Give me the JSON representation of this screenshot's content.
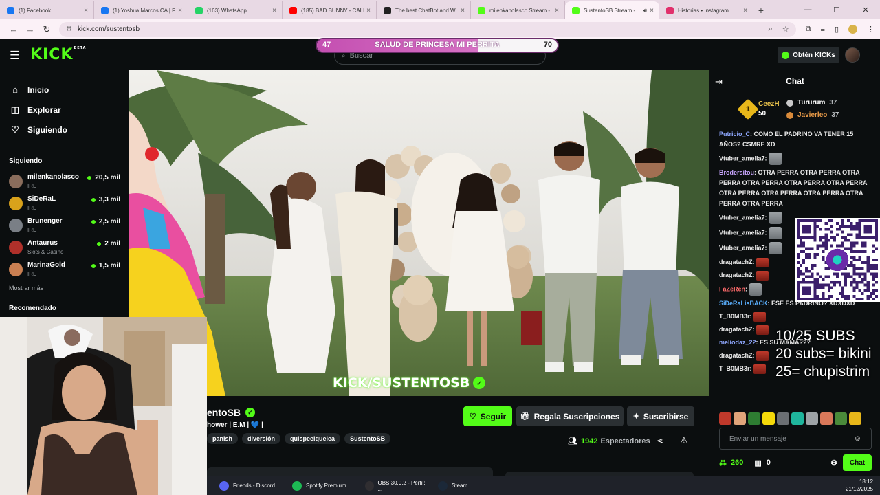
{
  "browser": {
    "tabs": [
      {
        "title": "(1) Facebook",
        "icon": "facebook-icon",
        "color": "#1877f2",
        "active": false
      },
      {
        "title": "(1) Yoshua Marcos CA | Fa",
        "icon": "facebook-icon",
        "color": "#1877f2",
        "active": false
      },
      {
        "title": "(163) WhatsApp",
        "icon": "whatsapp-icon",
        "color": "#25d366",
        "active": false
      },
      {
        "title": "(185) BAD BUNNY - CALL",
        "icon": "youtube-icon",
        "color": "#ff0000",
        "active": false
      },
      {
        "title": "The best ChatBot and W",
        "icon": "chatbot-icon",
        "color": "#222222",
        "active": false
      },
      {
        "title": "milenkanolasco Stream -",
        "icon": "kick-icon",
        "color": "#53fc18",
        "active": false
      },
      {
        "title": "SustentoSB Stream -",
        "icon": "kick-icon",
        "color": "#53fc18",
        "active": true
      },
      {
        "title": "Historias • Instagram",
        "icon": "instagram-icon",
        "color": "#e1306c",
        "active": false
      }
    ],
    "url": "kick.com/sustentosb"
  },
  "nav": {
    "logo": "KICK",
    "logo_badge": "BETA",
    "search_placeholder": "Buscar",
    "obten_kicks": "Obtén KICKs"
  },
  "goal": {
    "title": "SALUD DE PRINCESA MI PERRITA",
    "start": "47",
    "end": "70",
    "progress": 0.67
  },
  "sidebar": {
    "main": [
      {
        "label": "Inicio",
        "icon": "home-icon"
      },
      {
        "label": "Explorar",
        "icon": "compass-icon"
      },
      {
        "label": "Siguiendo",
        "icon": "heart-icon"
      }
    ],
    "following_title": "Siguiendo",
    "following": [
      {
        "name": "milenkanolasco",
        "category": "IRL",
        "viewers": "20,5 mil",
        "color": "#8a6d5c"
      },
      {
        "name": "SiDeRaL",
        "category": "IRL",
        "viewers": "3,3 mil",
        "color": "#d9a21b"
      },
      {
        "name": "Brunenger",
        "category": "IRL",
        "viewers": "2,5 mil",
        "color": "#7a7f86"
      },
      {
        "name": "Antaurus",
        "category": "Slots & Casino",
        "viewers": "2 mil",
        "color": "#b0302a"
      },
      {
        "name": "MarinaGold",
        "category": "IRL",
        "viewers": "1,5 mil",
        "color": "#c97f52"
      }
    ],
    "mostrar_mas": "Mostrar más",
    "recomendado": "Recomendado"
  },
  "video": {
    "watermark": "KICK/SUSTENTOSB"
  },
  "channel": {
    "name": "SustentoSB",
    "name_visible": "entoSB",
    "title_visible": "hower | E.M | 💙 |",
    "tags": [
      "panish",
      "diversión",
      "quispeelquelea",
      "SustentoSB"
    ],
    "follow": "Seguir",
    "gift": "Regala Suscripciones",
    "subscribe": "Suscribirse",
    "viewers": "1942",
    "viewers_label": "Espectadores"
  },
  "chat": {
    "title": "Chat",
    "leaderboard": [
      {
        "rank": "1",
        "name": "CeezH",
        "points": "50"
      },
      {
        "name": "Tururum",
        "points": "37",
        "color": "#c9c9c9"
      },
      {
        "name": "Javierleo",
        "points": "37",
        "color": "#d98a3a"
      }
    ],
    "messages": [
      {
        "user": "Putricio_C",
        "user_color": "#8fa8ff",
        "text": ": COMO EL PADRINO VA TENER 15 AÑOS? CSMRE XD",
        "emotes": 0,
        "emote_type": ""
      },
      {
        "user": "Vtuber_amelia7",
        "user_color": "#e8e8e8",
        "text": ":",
        "emotes": 1,
        "emote_type": "cat"
      },
      {
        "user": "Brodersitou",
        "user_color": "#c9a6ff",
        "text": ": OTRA PERRA  OTRA PERRA  OTRA PERRA  OTRA PERRA  OTRA PERRA  OTRA PERRA  OTRA PERRA  OTRA PERRA  OTRA PERRA  OTRA PERRA  OTRA PERRA",
        "emotes": 0,
        "emote_type": "red"
      },
      {
        "user": "Vtuber_amelia7",
        "user_color": "#e8e8e8",
        "text": ":",
        "emotes": 1,
        "emote_type": "cat"
      },
      {
        "user": "Vtuber_amelia7",
        "user_color": "#e8e8e8",
        "text": ":",
        "emotes": 1,
        "emote_type": "cat"
      },
      {
        "user": "Vtuber_amelia7",
        "user_color": "#e8e8e8",
        "text": ":",
        "emotes": 1,
        "emote_type": "cat"
      },
      {
        "user": "dragatachZ",
        "user_color": "#e8e8e8",
        "text": ":",
        "emotes": 1,
        "emote_type": "red"
      },
      {
        "user": "dragatachZ",
        "user_color": "#e8e8e8",
        "text": ":",
        "emotes": 1,
        "emote_type": "red"
      },
      {
        "user": "FaZeRen",
        "user_color": "#ff6b6b",
        "text": ":",
        "emotes": 1,
        "emote_type": "cat"
      },
      {
        "user": "SiDeRaLisBACK",
        "user_color": "#5ab0ff",
        "text": ": ESE ES PADRINO? XDXDXD",
        "emotes": 0,
        "emote_type": ""
      },
      {
        "user": "T_B0MB3r",
        "user_color": "#e8e8e8",
        "text": ":",
        "emotes": 1,
        "emote_type": "red"
      },
      {
        "user": "dragatachZ",
        "user_color": "#e8e8e8",
        "text": ":",
        "emotes": 1,
        "emote_type": "red"
      },
      {
        "user": "meliodaz_22",
        "user_color": "#8fa8ff",
        "text": ": ES SU MAMA???",
        "emotes": 0,
        "emote_type": ""
      },
      {
        "user": "dragatachZ",
        "user_color": "#e8e8e8",
        "text": ":",
        "emotes": 1,
        "emote_type": "red"
      },
      {
        "user": "T_B0MB3r",
        "user_color": "#e8e8e8",
        "text": ":",
        "emotes": 1,
        "emote_type": "red"
      }
    ],
    "subs_overlay": [
      "10/25 SUBS",
      "20 subs= bikini",
      "25= chupistrim"
    ],
    "input_placeholder": "Enviar un mensaje",
    "points": "260",
    "box_count": "0",
    "send": "Chat"
  },
  "taskbar": {
    "items": [
      {
        "label": "Friends - Discord",
        "icon": "discord-icon",
        "color": "#5865f2"
      },
      {
        "label": "Spotify Premium",
        "icon": "spotify-icon",
        "color": "#1db954"
      },
      {
        "label": "OBS 30.0.2 - Perfil: ...",
        "icon": "obs-icon",
        "color": "#302e31"
      },
      {
        "label": "Steam",
        "icon": "steam-icon",
        "color": "#1b2838"
      }
    ],
    "time": "18:12",
    "date": "21/12/2025"
  }
}
